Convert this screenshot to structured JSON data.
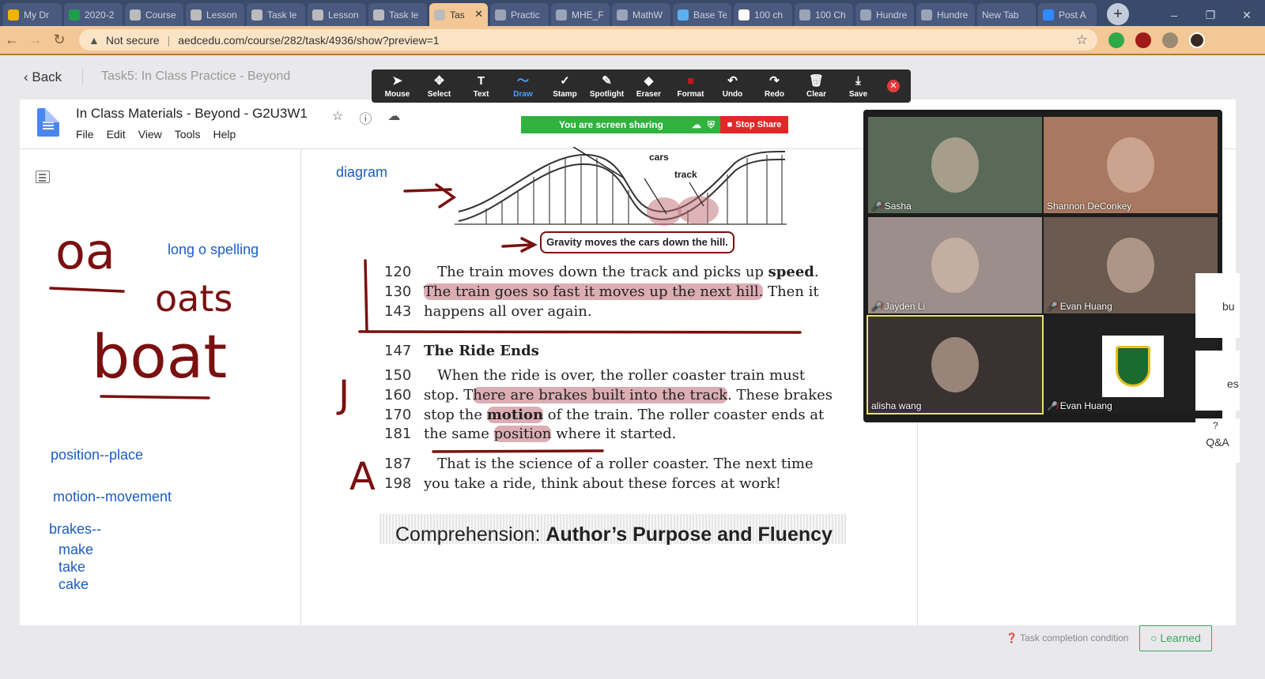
{
  "browser": {
    "tabs": [
      {
        "label": "My Dr",
        "icon_color": "#f0b400"
      },
      {
        "label": "2020-2",
        "icon_color": "#1e9e49"
      },
      {
        "label": "Course",
        "icon_color": "#bbbbbb"
      },
      {
        "label": "Lesson",
        "icon_color": "#bbbbbb"
      },
      {
        "label": "Task le",
        "icon_color": "#bbbbbb"
      },
      {
        "label": "Lesson",
        "icon_color": "#bbbbbb"
      },
      {
        "label": "Task le",
        "icon_color": "#bbbbbb"
      },
      {
        "label": "Tas",
        "icon_color": "#bbbbbb",
        "active": true
      },
      {
        "label": "Practic",
        "icon_color": "#9aa3b8"
      },
      {
        "label": "MHE_F",
        "icon_color": "#9aa3b8"
      },
      {
        "label": "MathW",
        "icon_color": "#9aa3b8"
      },
      {
        "label": "Base Te",
        "icon_color": "#5ab0f0"
      },
      {
        "label": "100 ch",
        "icon_color": "#ffffff"
      },
      {
        "label": "100 Ch",
        "icon_color": "#9aa3b8"
      },
      {
        "label": "Hundre",
        "icon_color": "#9aa3b8"
      },
      {
        "label": "Hundre",
        "icon_color": "#9aa3b8"
      },
      {
        "label": "New Tab",
        "icon_color": ""
      },
      {
        "label": "Post A",
        "icon_color": "#2d8cff"
      }
    ],
    "tab_close": "✕",
    "new_tab": "+",
    "window_controls": [
      "–",
      "❐",
      "✕"
    ],
    "security_label": "Not secure",
    "url": "aedcedu.com/course/282/task/4936/show?preview=1"
  },
  "page": {
    "back_label": "Back",
    "breadcrumb": "Task5:  In Class Practice - Beyond",
    "task_condition": "Task completion condition",
    "learned_label": "Learned",
    "qa_label": "Q&A",
    "side_fragment_1": "bu",
    "side_fragment_2": "es"
  },
  "doc": {
    "title": "In Class Materials - Beyond - G2U3W1",
    "menu": [
      "File",
      "Edit",
      "View",
      "Tools",
      "Help"
    ],
    "notes": {
      "diagram": "diagram",
      "long_o": "long o spelling",
      "position": "position--place",
      "motion": "motion--movement",
      "brakes": "brakes--",
      "rhymes": [
        "make",
        "take",
        "cake"
      ]
    },
    "handwriting": {
      "oa": "oa",
      "oats": "oats",
      "boat": "boat",
      "j_mark": "J",
      "a_mark": "A"
    },
    "diagram_labels": {
      "cars": "cars",
      "track": "track"
    },
    "caption": "Gravity moves the cars down the hill.",
    "lines": [
      {
        "num": "120",
        "text": "   The train moves down the track and picks up ",
        "bold": "speed",
        "after": "."
      },
      {
        "num": "130",
        "pre": "",
        "hl": "The train goes so fast it moves up the next hill.",
        "post": " Then it"
      },
      {
        "num": "143",
        "text": "happens all over again."
      },
      {
        "num": "147",
        "heading": "The Ride Ends"
      },
      {
        "num": "150",
        "text": "   When the ride is over, the roller coaster train must"
      },
      {
        "num": "160",
        "pre": "stop. T",
        "hl": "here are brakes built into the track",
        "post": ". These brakes"
      },
      {
        "num": "170",
        "pre": "stop the ",
        "hl_bold": "motion",
        "post": " of the train. The roller coaster ends at"
      },
      {
        "num": "181",
        "pre": "the same ",
        "hl": "position",
        "post": " where it started."
      },
      {
        "num": "187",
        "text": "   That is the science of a roller coaster. The next time"
      },
      {
        "num": "198",
        "text": "you take a ride, think about these forces at work!"
      }
    ],
    "comprehension_prefix": "Comprehension: ",
    "comprehension_bold": "Author’s Purpose and Fluency"
  },
  "zoom": {
    "tools": [
      {
        "label": "Mouse",
        "icon": "arrow-icon"
      },
      {
        "label": "Select",
        "icon": "move-icon"
      },
      {
        "label": "Text",
        "icon": "text-icon"
      },
      {
        "label": "Draw",
        "icon": "draw-icon",
        "selected": true
      },
      {
        "label": "Stamp",
        "icon": "check-icon"
      },
      {
        "label": "Spotlight",
        "icon": "spotlight-icon"
      },
      {
        "label": "Eraser",
        "icon": "eraser-icon"
      },
      {
        "label": "Format",
        "icon": "format-icon"
      },
      {
        "label": "Undo",
        "icon": "undo-icon"
      },
      {
        "label": "Redo",
        "icon": "redo-icon"
      },
      {
        "label": "Clear",
        "icon": "trash-icon"
      },
      {
        "label": "Save",
        "icon": "save-icon"
      }
    ],
    "sharing_text": "You are screen sharing",
    "stop_share": "Stop Share",
    "participants": [
      {
        "name": "Sasha",
        "muted": true,
        "bg": "#5a6a58"
      },
      {
        "name": "Shannon DeConkey",
        "muted": false,
        "bg": "#a87860"
      },
      {
        "name": "Jayden Li",
        "muted": true,
        "bg": "#9c8e8a"
      },
      {
        "name": "Evan Huang",
        "muted": true,
        "bg": "#6a5a50"
      },
      {
        "name": "alisha wang",
        "muted": false,
        "bg": "#3a3230",
        "active": true
      },
      {
        "name": "Evan Huang",
        "muted": true,
        "bg": "#202020",
        "logo": true
      }
    ]
  },
  "colors": {
    "ink": "#7a1010",
    "highlight": "#c06a74",
    "note_blue": "#1a5cc5",
    "share_green": "#2fb33e",
    "stop_red": "#e02828",
    "learned_green": "#3aa55a"
  }
}
